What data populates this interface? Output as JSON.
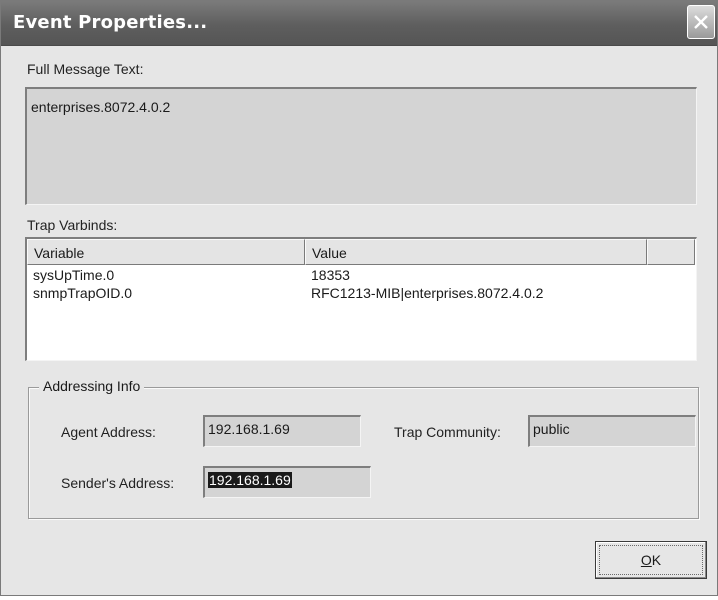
{
  "window": {
    "title": "Event Properties..."
  },
  "message": {
    "label": "Full Message Text:",
    "text": "enterprises.8072.4.0.2"
  },
  "varbinds": {
    "label": "Trap Varbinds:",
    "columns": [
      "Variable",
      "Value",
      ""
    ],
    "rows": [
      {
        "variable": "sysUpTime.0",
        "value": "18353"
      },
      {
        "variable": "snmpTrapOID.0",
        "value": "RFC1213-MIB|enterprises.8072.4.0.2"
      }
    ]
  },
  "addressing": {
    "group_label": "Addressing Info",
    "agent_label": "Agent Address:",
    "agent_value": "192.168.1.69",
    "community_label": "Trap Community:",
    "community_value": "public",
    "sender_label": "Sender's Address:",
    "sender_value": "192.168.1.69"
  },
  "buttons": {
    "ok_mnemonic": "O",
    "ok_rest": "K"
  },
  "icons": {
    "close": "close-icon"
  }
}
